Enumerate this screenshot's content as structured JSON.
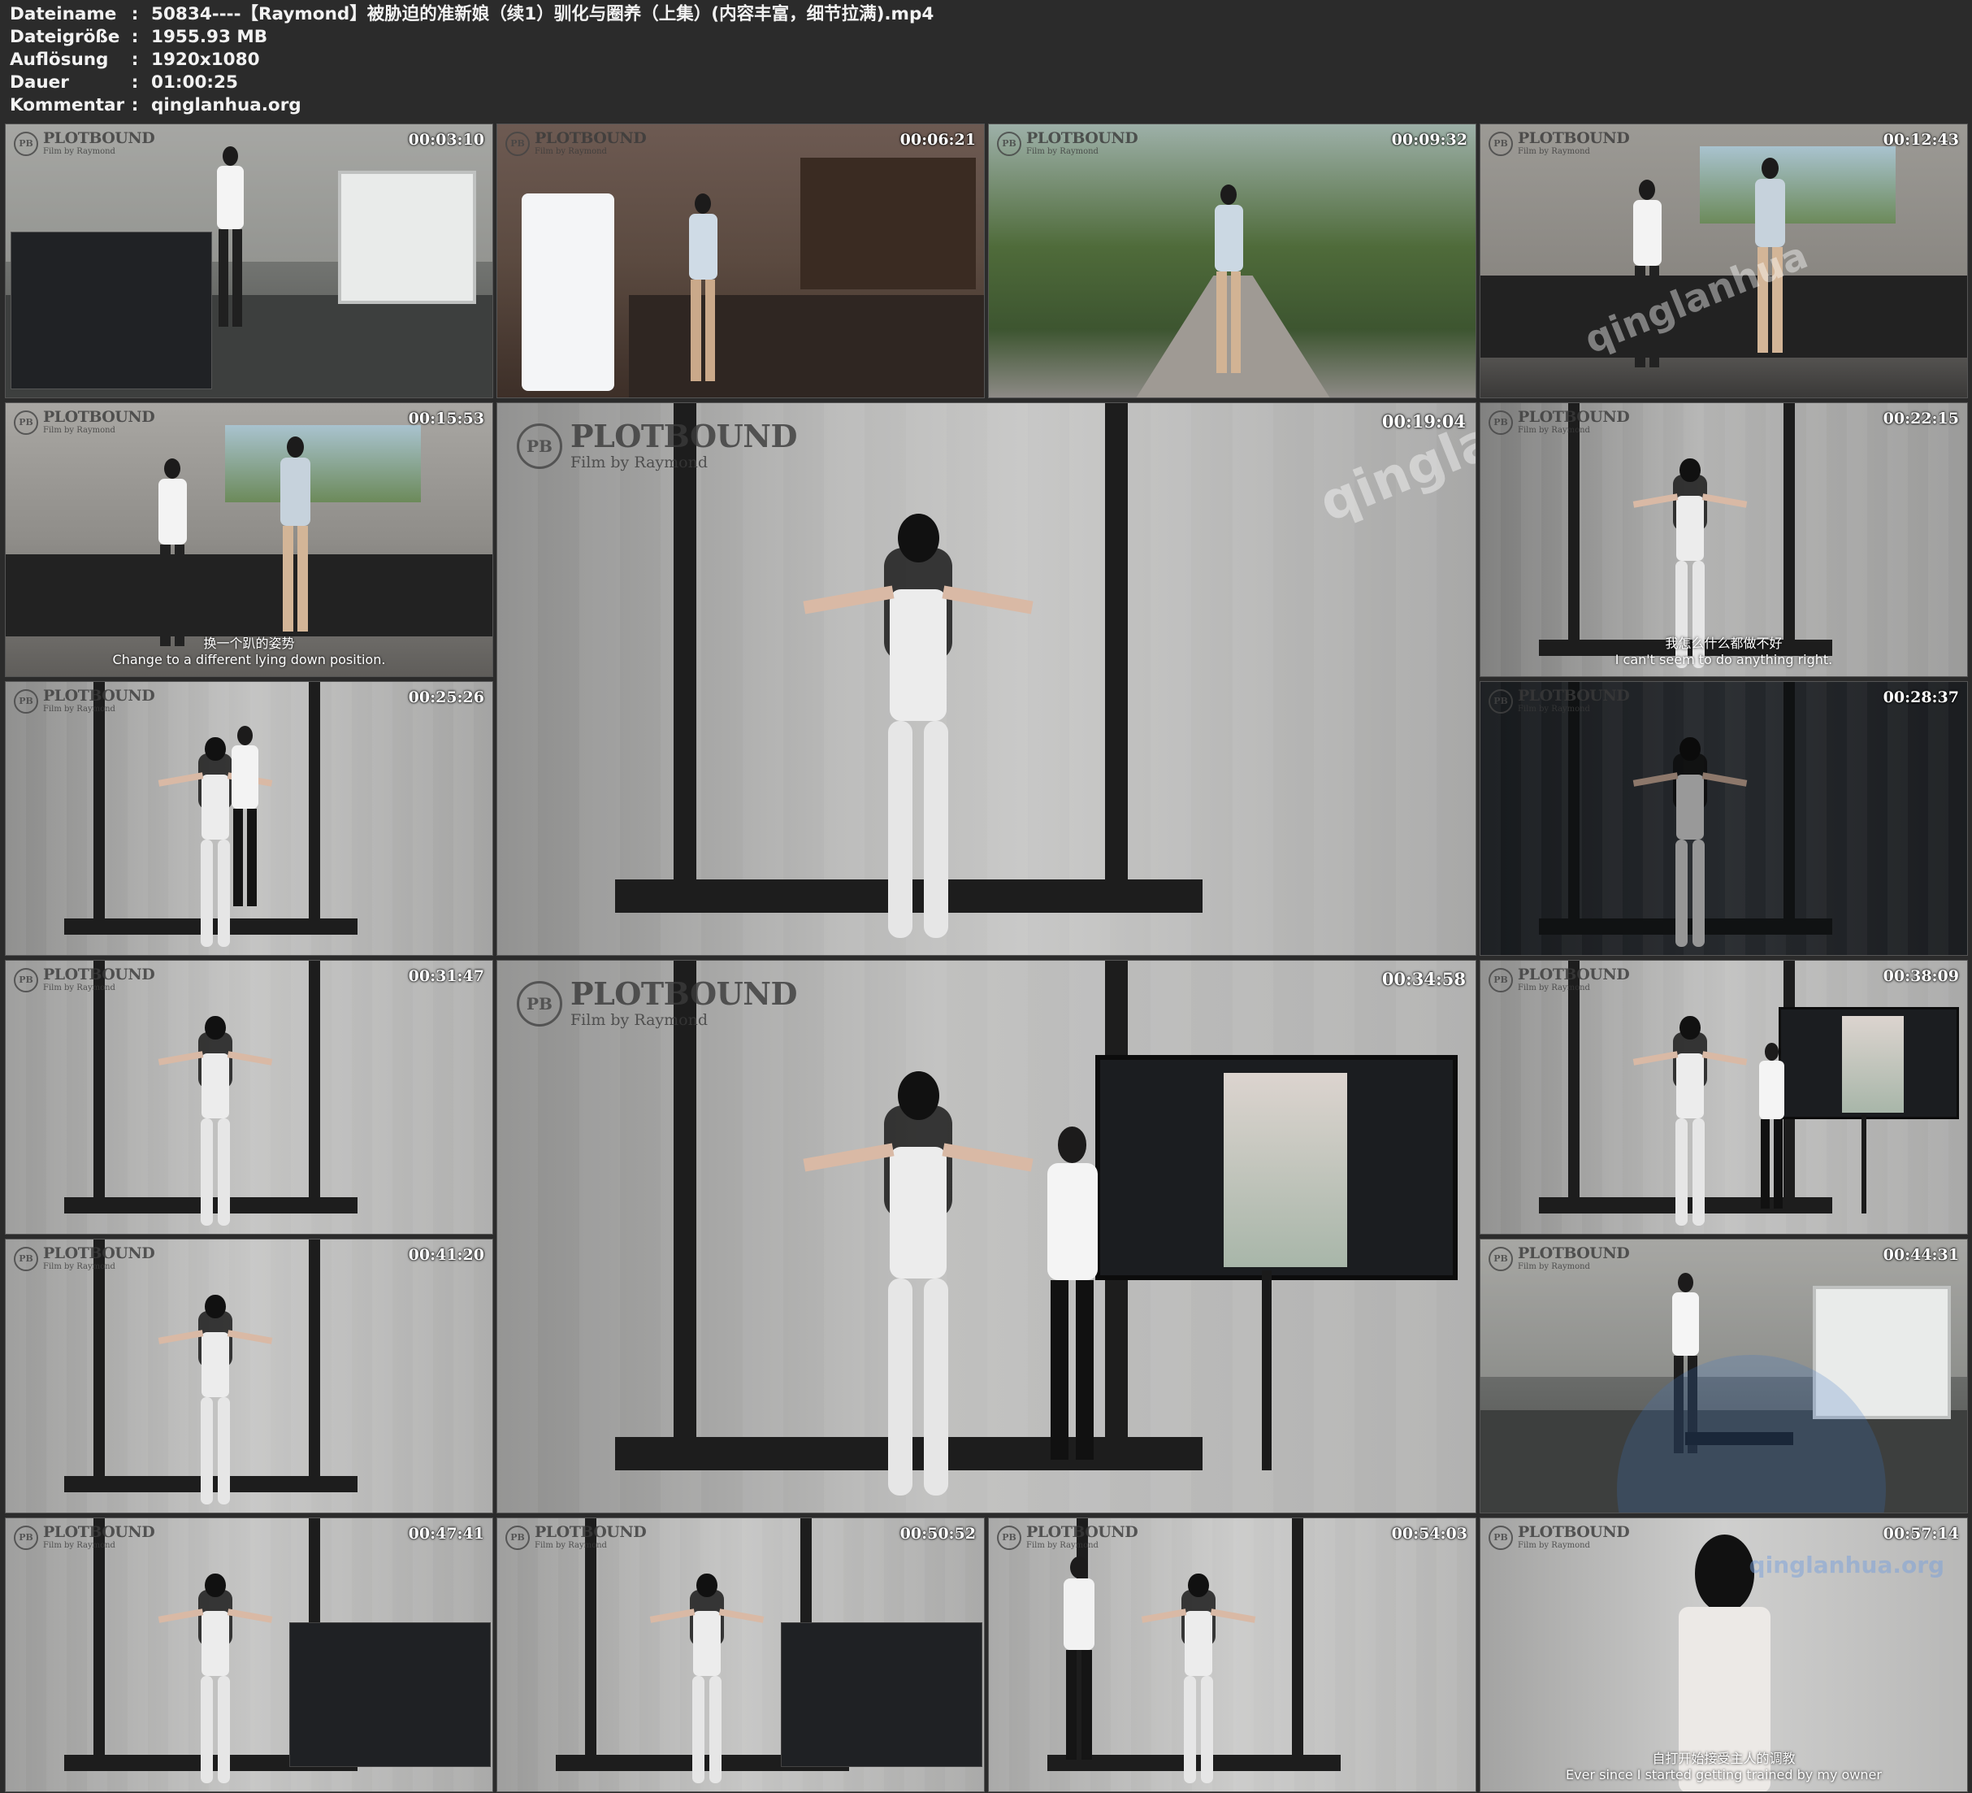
{
  "info": [
    {
      "key": "Dateiname",
      "value": "50834----【Raymond】被胁迫的准新娘（续1）驯化与圈养（上集）(内容丰富，细节拉满).mp4"
    },
    {
      "key": "Dateigröße",
      "value": "1955.93 MB"
    },
    {
      "key": "Auflösung",
      "value": "1920x1080"
    },
    {
      "key": "Dauer",
      "value": "01:00:25"
    },
    {
      "key": "Kommentar",
      "value": "qinglanhua.org"
    }
  ],
  "separator": ":",
  "logo": {
    "mark": "PB",
    "title": "PLOTBOUND",
    "subtitle": "Film by Raymond"
  },
  "watermark": "qinglanhua",
  "watermark2": "qinglanhua.org",
  "thumbs": [
    {
      "time": "00:03:10",
      "subtitle_zh": "",
      "subtitle_en": ""
    },
    {
      "time": "00:06:21",
      "subtitle_zh": "",
      "subtitle_en": ""
    },
    {
      "time": "00:09:32",
      "subtitle_zh": "",
      "subtitle_en": ""
    },
    {
      "time": "00:12:43",
      "subtitle_zh": "",
      "subtitle_en": ""
    },
    {
      "time": "00:15:53",
      "subtitle_zh": "换一个趴的姿势",
      "subtitle_en": "Change to a different lying down position."
    },
    {
      "time": "00:19:04",
      "subtitle_zh": "",
      "subtitle_en": ""
    },
    {
      "time": "00:22:15",
      "subtitle_zh": "我怎么什么都做不好",
      "subtitle_en": "I can't seem to do anything right."
    },
    {
      "time": "00:25:26",
      "subtitle_zh": "",
      "subtitle_en": ""
    },
    {
      "time": "00:28:37",
      "subtitle_zh": "",
      "subtitle_en": ""
    },
    {
      "time": "00:31:47",
      "subtitle_zh": "",
      "subtitle_en": ""
    },
    {
      "time": "00:34:58",
      "subtitle_zh": "",
      "subtitle_en": ""
    },
    {
      "time": "00:38:09",
      "subtitle_zh": "",
      "subtitle_en": ""
    },
    {
      "time": "00:41:20",
      "subtitle_zh": "",
      "subtitle_en": ""
    },
    {
      "time": "00:44:31",
      "subtitle_zh": "",
      "subtitle_en": ""
    },
    {
      "time": "00:47:41",
      "subtitle_zh": "",
      "subtitle_en": ""
    },
    {
      "time": "00:50:52",
      "subtitle_zh": "",
      "subtitle_en": ""
    },
    {
      "time": "00:54:03",
      "subtitle_zh": "",
      "subtitle_en": ""
    },
    {
      "time": "00:57:14",
      "subtitle_zh": "自打开始接受主人的调教",
      "subtitle_en": "Ever since I started getting trained by my owner"
    }
  ]
}
